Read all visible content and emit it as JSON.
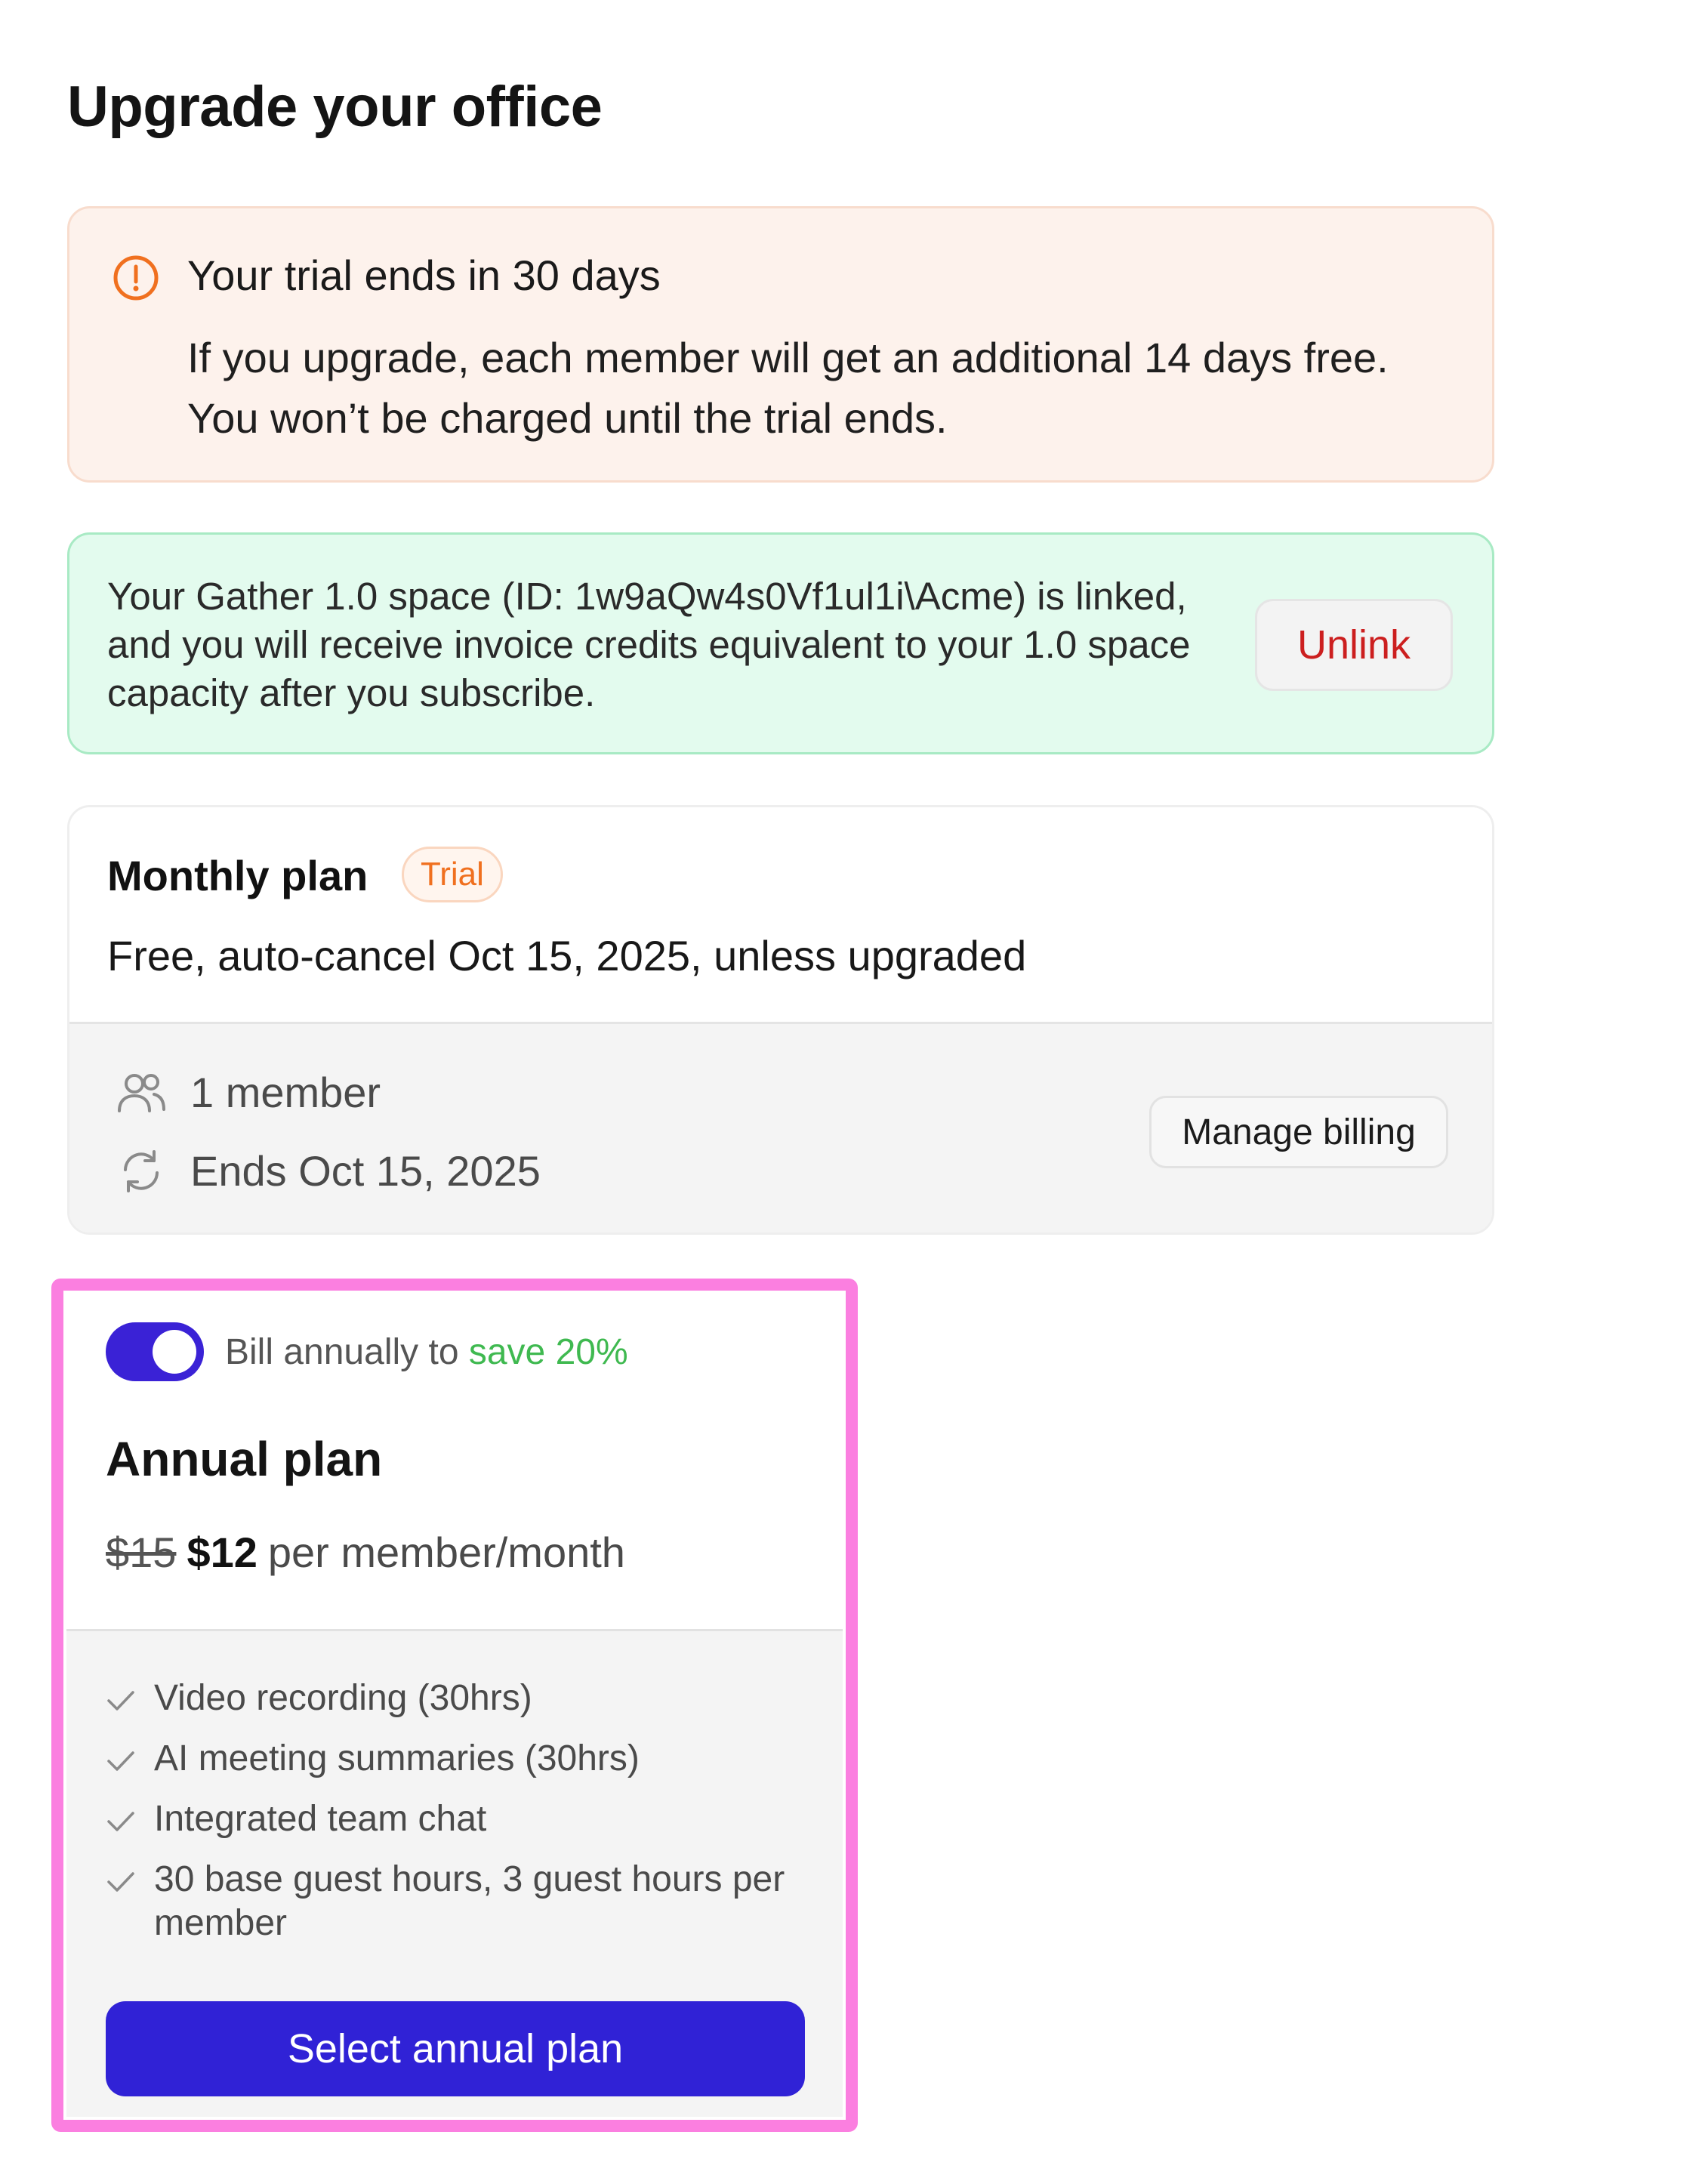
{
  "page": {
    "title": "Upgrade your office"
  },
  "trial_notice": {
    "icon": "alert-circle-icon",
    "title": "Your trial ends in 30 days",
    "body": "If you upgrade, each member will get an additional 14 days free. You won’t be charged until the trial ends.",
    "accent_color": "#f0701f"
  },
  "linked_space": {
    "text": "Your Gather 1.0 space (ID: 1w9aQw4s0Vf1ul1i\\Acme) is linked, and you will receive invoice credits equivalent to your 1.0 space capacity after you subscribe.",
    "unlink_label": "Unlink"
  },
  "monthly_plan": {
    "title": "Monthly plan",
    "badge": "Trial",
    "subtitle": "Free, auto-cancel Oct 15, 2025, unless upgraded",
    "members": "1 member",
    "members_icon": "users-icon",
    "ends": "Ends Oct 15, 2025",
    "ends_icon": "refresh-icon",
    "manage_label": "Manage billing"
  },
  "annual_plan": {
    "toggle_on": true,
    "toggle_label": "Bill annually to",
    "toggle_save": "save 20%",
    "title": "Annual plan",
    "price_old": "$15",
    "price_new": "$12",
    "price_unit": "per member/month",
    "features": [
      "Video recording (30hrs)",
      "AI meeting summaries (30hrs)",
      "Integrated team chat",
      "30 base guest hours, 3 guest hours per member"
    ],
    "select_label": "Select annual plan",
    "button_color": "#3022d6",
    "highlight_color": "#fb7fe0"
  }
}
